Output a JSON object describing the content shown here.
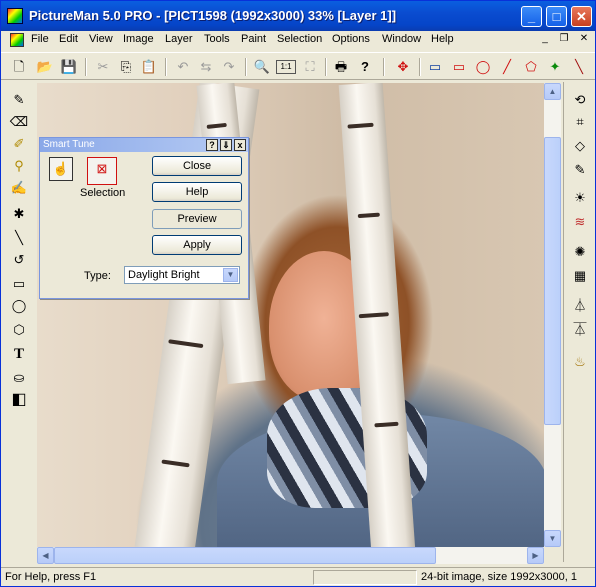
{
  "window": {
    "title": "PictureMan 5.0 PRO - [PICT1598 (1992x3000) 33% [Layer 1]]",
    "caption_min": "_",
    "caption_max": "□",
    "caption_close": "✕"
  },
  "menu": {
    "items": [
      "File",
      "Edit",
      "View",
      "Image",
      "Layer",
      "Tools",
      "Paint",
      "Selection",
      "Options",
      "Window",
      "Help"
    ],
    "mdi_min": "_",
    "mdi_restore": "❐",
    "mdi_close": "✕"
  },
  "toolbar": {
    "icons": [
      "new-icon",
      "open-icon",
      "save-icon",
      "cut-icon",
      "copy-icon",
      "paste-icon",
      "undo-icon",
      "flip-icon",
      "redo-icon",
      "zoom-icon",
      "actual-size-icon",
      "fit-icon",
      "print-icon",
      "help-pointer-icon",
      "pointer-move-icon",
      "window-icon",
      "rectangle-icon",
      "ellipse-icon",
      "line-icon",
      "polygon-icon",
      "magic-wand-icon",
      "brush-tool-icon"
    ],
    "glyphs": [
      "🗋",
      "📂",
      "💾",
      "✂",
      "⎘",
      "📋",
      "↶",
      "⇆",
      "↷",
      "🔍",
      "1:1",
      "⛶",
      "🖶",
      "?",
      "✥",
      "▭",
      "▭",
      "◯",
      "╱",
      "⬠",
      "✦",
      "╲"
    ]
  },
  "lefttools": {
    "icons": [
      "eyedropper-icon",
      "eraser-icon",
      "brush-icon",
      "stamp-icon",
      "fill-icon",
      "airbrush-icon",
      "line-tool-icon",
      "curve-icon",
      "rectangle-tool-icon",
      "ellipse-tool-icon",
      "polygon-tool-icon",
      "text-icon",
      "paint-bucket-icon",
      "color-swatch-icon"
    ],
    "glyphs": [
      "✎",
      "⌫",
      "✐",
      "⚲",
      "✍",
      "✱",
      "╲",
      "↺",
      "▭",
      "◯",
      "⬡",
      "T",
      "⛀",
      "◧"
    ]
  },
  "righttools": {
    "icons": [
      "rotate-icon",
      "crop-icon",
      "perspective-icon",
      "dropper-icon",
      "brightness-icon",
      "curves-icon",
      "swirl-icon",
      "texture-icon",
      "levels-icon",
      "channels-icon",
      "sharpen-icon"
    ],
    "glyphs": [
      "⟲",
      "⌗",
      "◇",
      "✎",
      "☀",
      "≋",
      "✺",
      "▦",
      "⏃",
      "⏄",
      "♨"
    ]
  },
  "smart_tune": {
    "title": "Smart Tune",
    "cap_help": "?",
    "cap_pin": "⇓",
    "cap_close": "x",
    "selection_label": "Selection",
    "buttons": {
      "close": "Close",
      "help": "Help",
      "preview": "Preview",
      "apply": "Apply"
    },
    "type_label": "Type:",
    "type_value": "Daylight Bright"
  },
  "scroll": {
    "up": "▲",
    "down": "▼",
    "left": "◀",
    "right": "▶"
  },
  "status": {
    "help_text": "For Help, press F1",
    "image_info": "24-bit image, size 1992x3000, 1"
  }
}
